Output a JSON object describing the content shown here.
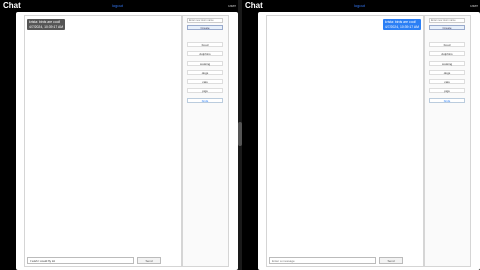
{
  "app": {
    "title": "Chat",
    "logout_label": "logout",
    "username": "user"
  },
  "left": {
    "message": {
      "text": "krista: birds are cool!",
      "timestamp": "4/7/2024, 10:39:17 AM"
    },
    "compose": {
      "value": "I wish I could fly lol",
      "send_label": "Send"
    },
    "sidebar": {
      "search_placeholder": "Enter new room name",
      "create_label": "Create",
      "rooms": [
        "Food",
        "dolphins",
        "cooking",
        "dogs",
        "cats",
        "pigs",
        "birds"
      ],
      "active_room": "birds"
    }
  },
  "right": {
    "message": {
      "text": "krista: birds are cool!",
      "timestamp": "4/7/2024, 10:39:17 AM"
    },
    "compose": {
      "placeholder": "Enter a message",
      "send_label": "Send"
    },
    "sidebar": {
      "search_placeholder": "Enter new room name",
      "create_label": "Create",
      "rooms": [
        "Food",
        "dolphins",
        "cooking",
        "dogs",
        "cats",
        "pigs",
        "birds"
      ],
      "active_room": "birds"
    }
  },
  "colors": {
    "self_message": "#2b7ff5",
    "other_message": "#555555",
    "active_room": "#2b7ff5"
  }
}
